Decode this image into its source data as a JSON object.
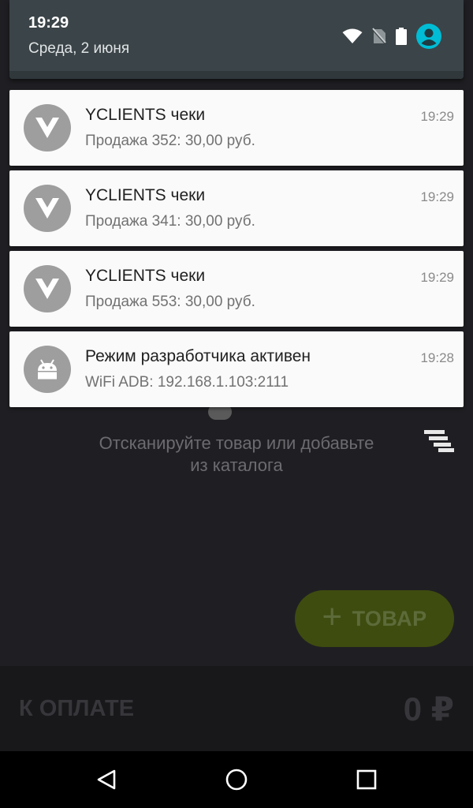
{
  "status": {
    "time": "19:29",
    "date": "Среда, 2 июня",
    "icons": [
      "wifi-icon",
      "no-sim-icon",
      "battery-icon",
      "account-icon"
    ]
  },
  "notifications": [
    {
      "app": "yclients-icon",
      "title": "YCLIENTS чеки",
      "text": "Продажа 352: 30,00 руб.",
      "time": "19:29"
    },
    {
      "app": "yclients-icon",
      "title": "YCLIENTS чеки",
      "text": "Продажа 341: 30,00 руб.",
      "time": "19:29"
    },
    {
      "app": "yclients-icon",
      "title": "YCLIENTS чеки",
      "text": "Продажа 553: 30,00 руб.",
      "time": "19:29"
    },
    {
      "app": "android-icon",
      "title": "Режим разработчика активен",
      "text": "WiFi ADB: 192.168.1.103:2111",
      "time": "19:28"
    }
  ],
  "app": {
    "scan_hint_line1": "Отсканируйте товар или добавьте",
    "scan_hint_line2": "из каталога",
    "add_item_label": "ТОВАР",
    "pay_label": "К ОПЛАТЕ",
    "pay_amount": "0 ₽"
  },
  "colors": {
    "shade_header": "#3b4448",
    "card": "#fafafa",
    "accent_avatar": "#00bcd4",
    "fab": "#3e4c10"
  }
}
